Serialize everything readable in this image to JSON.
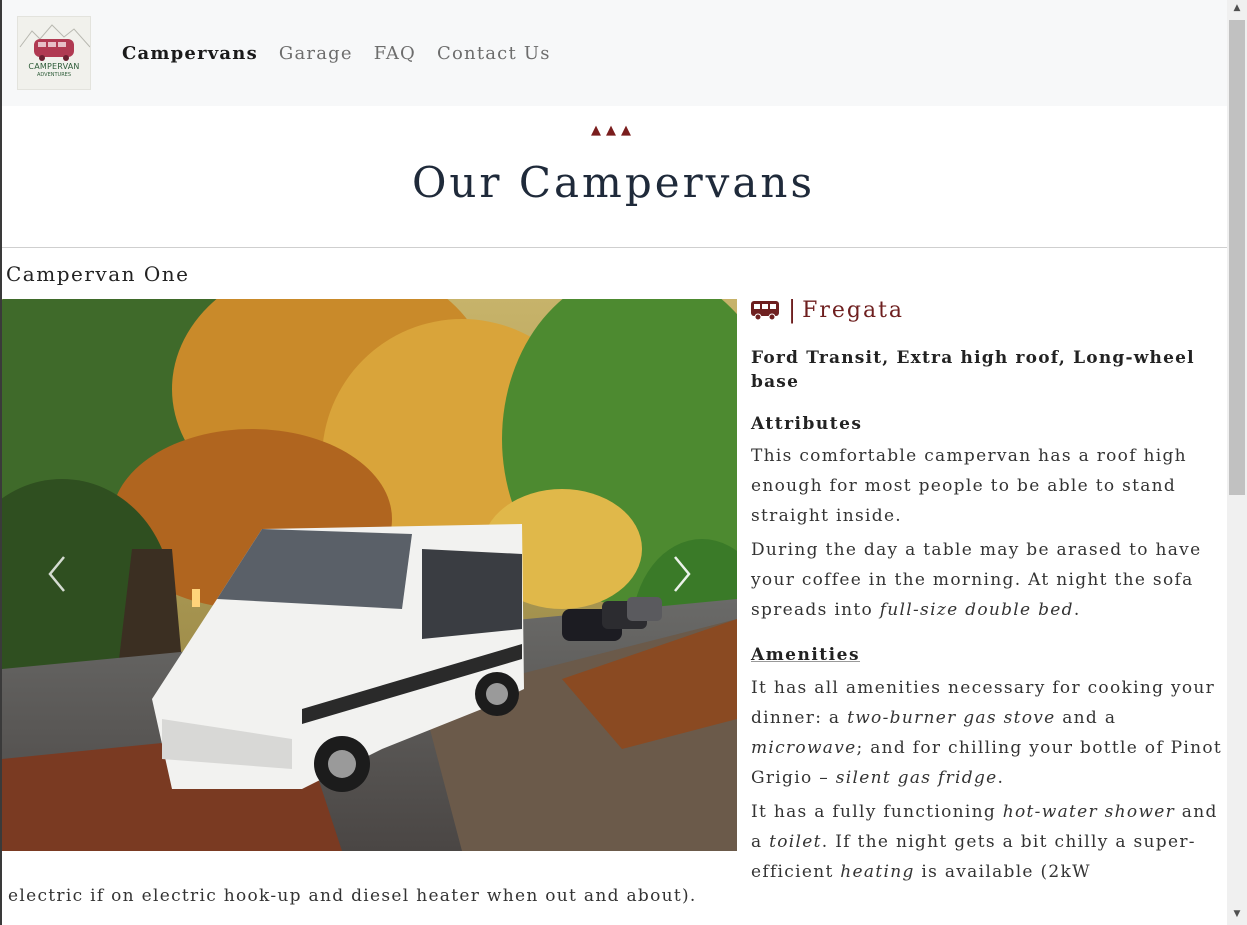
{
  "nav": {
    "logo_text": "CAMPERVAN",
    "logo_sub": "ADVENTURES",
    "links": [
      "Campervans",
      "Garage",
      "FAQ",
      "Contact Us"
    ],
    "active": "Campervans"
  },
  "header": {
    "ornament": "▲▲▲",
    "title": "Our Campervans"
  },
  "van": {
    "name": "Campervan One",
    "model": "Fregata",
    "separator": "|",
    "subtitle": "Ford Transit, Extra high roof, Long-wheel base",
    "attributes_title": "Attributes",
    "amenities_title": "Amenities",
    "attr_p1": "This comfortable campervan has a roof high enough for most people to be able to stand straight inside.",
    "attr_p2_a": "During the day a table may be arased to have your coffee in the morning. At night the sofa spreads into ",
    "attr_p2_em": "full-size double bed",
    "attr_p2_b": ".",
    "amen_p1_a": "It has all amenities necessary for cooking your dinner: a ",
    "amen_p1_em1": "two-burner gas stove",
    "amen_p1_b": " and a ",
    "amen_p1_em2": "microwave",
    "amen_p1_c": "; and for chilling your bottle of Pinot Grigio – ",
    "amen_p1_em3": "silent gas fridge",
    "amen_p1_d": ".",
    "amen_p2_a": "It has a fully functioning ",
    "amen_p2_em1": "hot-water shower",
    "amen_p2_b": " and a ",
    "amen_p2_em2": "toilet",
    "amen_p2_c": ". If the night gets a bit chilly a super-efficient ",
    "amen_p2_em3": "heating",
    "amen_p2_d": " is available (2kW",
    "amen_p2_tail": "electric if on electric hook-up and diesel heater when out and about)."
  },
  "icons": {
    "van": "van-icon",
    "prev": "chevron-left-icon",
    "next": "chevron-right-icon"
  },
  "colors": {
    "accent": "#6e1f1f",
    "title": "#1f2a3a",
    "navbar_bg": "#f7f8f9"
  }
}
